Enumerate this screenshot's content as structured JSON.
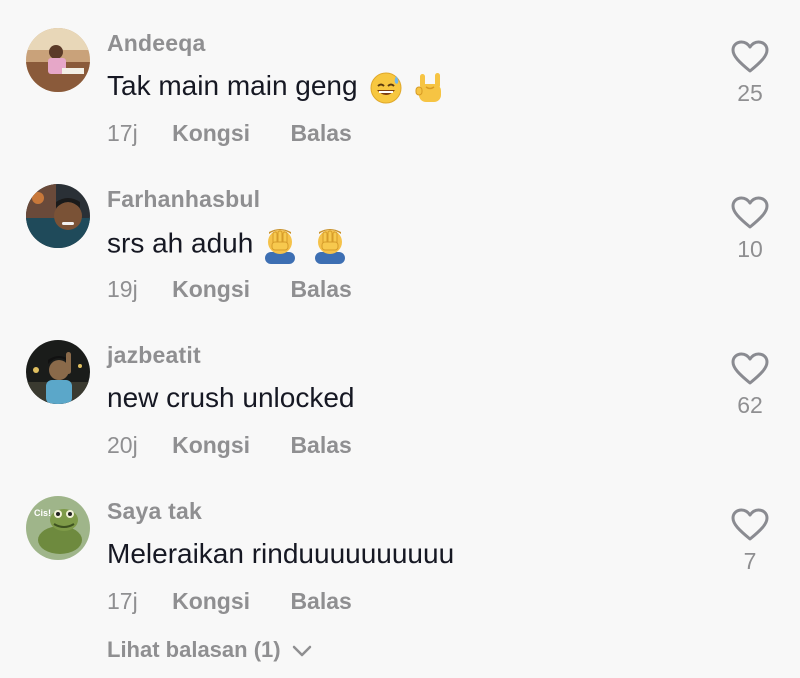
{
  "comments": [
    {
      "username": "Andeeqa",
      "text": "Tak main main geng",
      "emojis": [
        "sweat-smile-emoji",
        "rock-on-hand-emoji"
      ],
      "time": "17j",
      "share_label": "Kongsi",
      "reply_label": "Balas",
      "likes": "25"
    },
    {
      "username": "Farhanhasbul",
      "text": "srs ah aduh",
      "emojis": [
        "facepalm-emoji",
        "facepalm-emoji"
      ],
      "time": "19j",
      "share_label": "Kongsi",
      "reply_label": "Balas",
      "likes": "10"
    },
    {
      "username": "jazbeatit",
      "text": "new crush unlocked",
      "emojis": [],
      "time": "20j",
      "share_label": "Kongsi",
      "reply_label": "Balas",
      "likes": "62"
    },
    {
      "username": "Saya tak",
      "text": "Meleraikan rinduuuuuuuuuu",
      "emojis": [],
      "time": "17j",
      "share_label": "Kongsi",
      "reply_label": "Balas",
      "likes": "7",
      "avatar_text": "Cis!"
    }
  ],
  "view_replies_label": "Lihat balasan (1)",
  "colors": {
    "background": "#f8f8f8",
    "primary_text": "#161823",
    "secondary_text": "#8f8f91",
    "heart_outline": "#8a8b91"
  }
}
